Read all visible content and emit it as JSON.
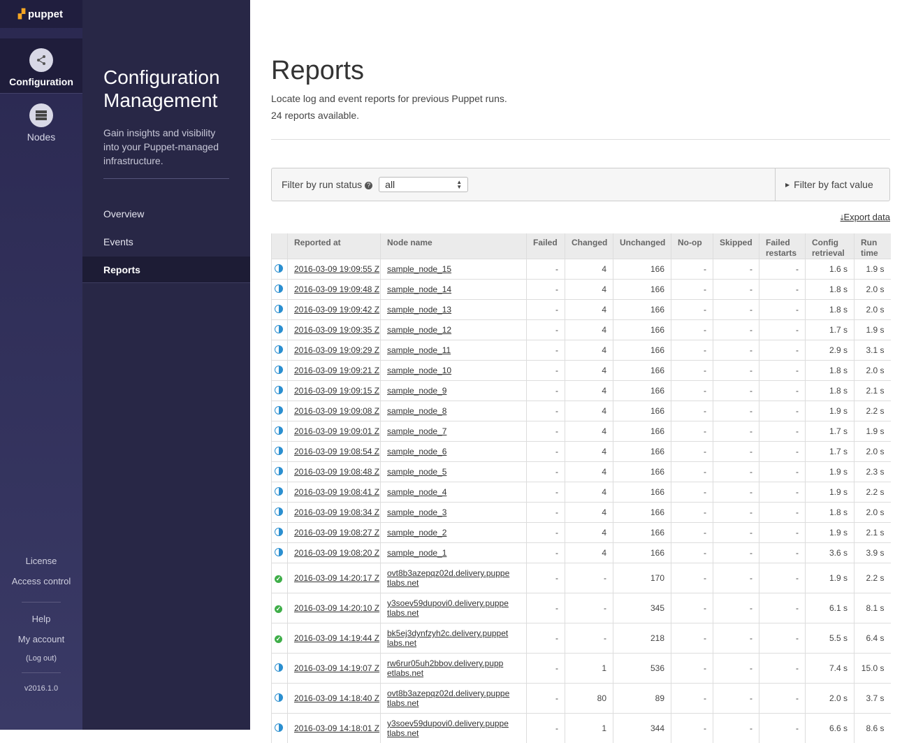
{
  "brand": {
    "name": "puppet"
  },
  "rail": {
    "items": [
      {
        "label": "Configuration",
        "icon": "share-icon",
        "active": true
      },
      {
        "label": "Nodes",
        "icon": "server-icon",
        "active": false
      }
    ],
    "bottom": {
      "license": "License",
      "access": "Access control",
      "help": "Help",
      "account": "My account",
      "logout": "(Log out)",
      "version": "v2016.1.0"
    }
  },
  "panel": {
    "title_line1": "Configuration",
    "title_line2": "Management",
    "description": "Gain insights and visibility into your Puppet-managed infrastructure.",
    "nav": [
      "Overview",
      "Events",
      "Reports"
    ],
    "active_nav": "Reports"
  },
  "main": {
    "title": "Reports",
    "subtitle": "Locate log and event reports for previous Puppet runs.",
    "count_text": "24 reports available.",
    "filter_label": "Filter by run status",
    "filter_value": "all",
    "fact_filter": "Filter by fact value",
    "export": "Export data"
  },
  "table": {
    "headers": [
      "Reported at",
      "Node name",
      "Failed",
      "Changed",
      "Unchanged",
      "No-op",
      "Skipped",
      "Failed restarts",
      "Config retrieval",
      "Run time"
    ],
    "rows": [
      [
        "changed",
        "2016-03-09 19:09:55 Z",
        "sample_node_15",
        "-",
        "4",
        "166",
        "-",
        "-",
        "-",
        "1.6 s",
        "1.9 s"
      ],
      [
        "changed",
        "2016-03-09 19:09:48 Z",
        "sample_node_14",
        "-",
        "4",
        "166",
        "-",
        "-",
        "-",
        "1.8 s",
        "2.0 s"
      ],
      [
        "changed",
        "2016-03-09 19:09:42 Z",
        "sample_node_13",
        "-",
        "4",
        "166",
        "-",
        "-",
        "-",
        "1.8 s",
        "2.0 s"
      ],
      [
        "changed",
        "2016-03-09 19:09:35 Z",
        "sample_node_12",
        "-",
        "4",
        "166",
        "-",
        "-",
        "-",
        "1.7 s",
        "1.9 s"
      ],
      [
        "changed",
        "2016-03-09 19:09:29 Z",
        "sample_node_11",
        "-",
        "4",
        "166",
        "-",
        "-",
        "-",
        "2.9 s",
        "3.1 s"
      ],
      [
        "changed",
        "2016-03-09 19:09:21 Z",
        "sample_node_10",
        "-",
        "4",
        "166",
        "-",
        "-",
        "-",
        "1.8 s",
        "2.0 s"
      ],
      [
        "changed",
        "2016-03-09 19:09:15 Z",
        "sample_node_9",
        "-",
        "4",
        "166",
        "-",
        "-",
        "-",
        "1.8 s",
        "2.1 s"
      ],
      [
        "changed",
        "2016-03-09 19:09:08 Z",
        "sample_node_8",
        "-",
        "4",
        "166",
        "-",
        "-",
        "-",
        "1.9 s",
        "2.2 s"
      ],
      [
        "changed",
        "2016-03-09 19:09:01 Z",
        "sample_node_7",
        "-",
        "4",
        "166",
        "-",
        "-",
        "-",
        "1.7 s",
        "1.9 s"
      ],
      [
        "changed",
        "2016-03-09 19:08:54 Z",
        "sample_node_6",
        "-",
        "4",
        "166",
        "-",
        "-",
        "-",
        "1.7 s",
        "2.0 s"
      ],
      [
        "changed",
        "2016-03-09 19:08:48 Z",
        "sample_node_5",
        "-",
        "4",
        "166",
        "-",
        "-",
        "-",
        "1.9 s",
        "2.3 s"
      ],
      [
        "changed",
        "2016-03-09 19:08:41 Z",
        "sample_node_4",
        "-",
        "4",
        "166",
        "-",
        "-",
        "-",
        "1.9 s",
        "2.2 s"
      ],
      [
        "changed",
        "2016-03-09 19:08:34 Z",
        "sample_node_3",
        "-",
        "4",
        "166",
        "-",
        "-",
        "-",
        "1.8 s",
        "2.0 s"
      ],
      [
        "changed",
        "2016-03-09 19:08:27 Z",
        "sample_node_2",
        "-",
        "4",
        "166",
        "-",
        "-",
        "-",
        "1.9 s",
        "2.1 s"
      ],
      [
        "changed",
        "2016-03-09 19:08:20 Z",
        "sample_node_1",
        "-",
        "4",
        "166",
        "-",
        "-",
        "-",
        "3.6 s",
        "3.9 s"
      ],
      [
        "ok",
        "2016-03-09 14:20:17 Z",
        "ovt8b3azepqz02d.delivery.puppe tlabs.net",
        "-",
        "-",
        "170",
        "-",
        "-",
        "-",
        "1.9 s",
        "2.2 s"
      ],
      [
        "ok",
        "2016-03-09 14:20:10 Z",
        "y3soev59dupovi0.delivery.puppe tlabs.net",
        "-",
        "-",
        "345",
        "-",
        "-",
        "-",
        "6.1 s",
        "8.1 s"
      ],
      [
        "ok",
        "2016-03-09 14:19:44 Z",
        "bk5ej3dynfzyh2c.delivery.puppet labs.net",
        "-",
        "-",
        "218",
        "-",
        "-",
        "-",
        "5.5 s",
        "6.4 s"
      ],
      [
        "changed",
        "2016-03-09 14:19:07 Z",
        "rw6rur05uh2bbov.delivery.pupp etlabs.net",
        "-",
        "1",
        "536",
        "-",
        "-",
        "-",
        "7.4 s",
        "15.0 s"
      ],
      [
        "changed",
        "2016-03-09 14:18:40 Z",
        "ovt8b3azepqz02d.delivery.puppe tlabs.net",
        "-",
        "80",
        "89",
        "-",
        "-",
        "-",
        "2.0 s",
        "3.7 s"
      ],
      [
        "changed",
        "2016-03-09 14:18:01 Z",
        "y3soev59dupovi0.delivery.puppe tlabs.net",
        "-",
        "1",
        "344",
        "-",
        "-",
        "-",
        "6.6 s",
        "8.6 s"
      ]
    ]
  }
}
